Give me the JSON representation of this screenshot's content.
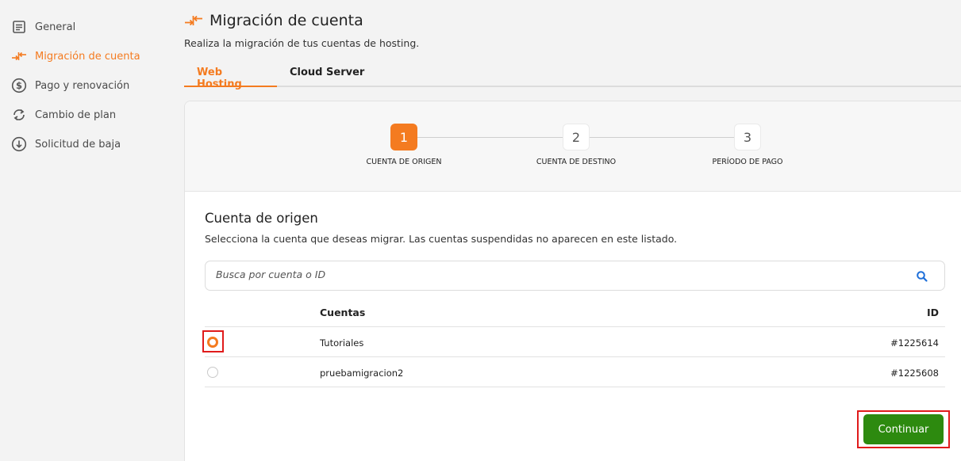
{
  "sidebar": {
    "items": [
      {
        "label": "General",
        "icon": "document-icon"
      },
      {
        "label": "Migración de cuenta",
        "icon": "migrate-arrows-icon",
        "active": true
      },
      {
        "label": "Pago y renovación",
        "icon": "dollar-circle-icon"
      },
      {
        "label": "Cambio de plan",
        "icon": "refresh-icon"
      },
      {
        "label": "Solicitud de baja",
        "icon": "arrow-down-circle-icon"
      }
    ]
  },
  "header": {
    "title": "Migración de cuenta",
    "subtitle": "Realiza la migración de tus cuentas de hosting."
  },
  "tabs": [
    {
      "label": "Web Hosting",
      "active": true
    },
    {
      "label": "Cloud Server",
      "active": false
    }
  ],
  "stepper": {
    "steps": [
      {
        "number": "1",
        "label": "CUENTA DE ORIGEN",
        "active": true
      },
      {
        "number": "2",
        "label": "CUENTA DE DESTINO",
        "active": false
      },
      {
        "number": "3",
        "label": "PERÍODO DE PAGO",
        "active": false
      }
    ]
  },
  "section": {
    "title": "Cuenta de origen",
    "description": "Selecciona la cuenta que deseas migrar. Las cuentas suspendidas no aparecen en este listado."
  },
  "search": {
    "placeholder": "Busca por cuenta o ID",
    "value": ""
  },
  "table": {
    "headers": {
      "accounts": "Cuentas",
      "id": "ID"
    },
    "rows": [
      {
        "account": "Tutoriales",
        "id": "#1225614",
        "selected": true
      },
      {
        "account": "pruebamigracion2",
        "id": "#1225608",
        "selected": false
      }
    ]
  },
  "actions": {
    "continue_label": "Continuar"
  },
  "colors": {
    "accent": "#f47b20",
    "primary_button": "#2d8a0f",
    "highlight_box": "#e01b1b"
  }
}
